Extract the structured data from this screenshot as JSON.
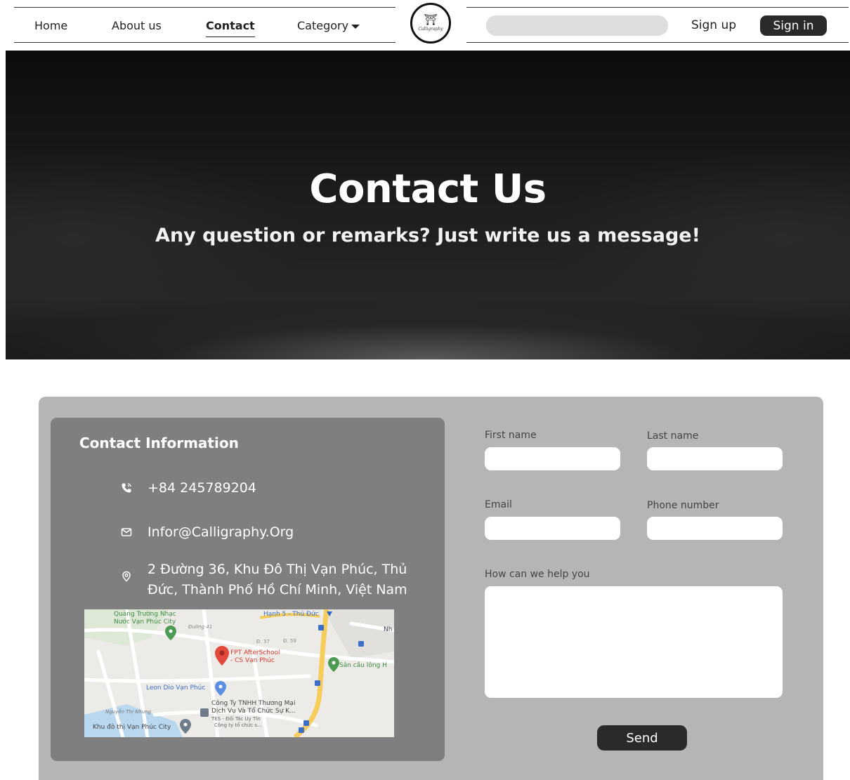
{
  "nav": {
    "links": [
      {
        "label": "Home"
      },
      {
        "label": "About us"
      },
      {
        "label": "Contact"
      },
      {
        "label": "Category"
      }
    ],
    "logo_text": "Calligraphy",
    "logo_glyph": "⛩",
    "search_placeholder": "",
    "signup_label": "Sign up",
    "signin_label": "Sign in"
  },
  "hero": {
    "title": "Contact Us",
    "subtitle": "Any question or remarks? Just write us a message!"
  },
  "contact_info": {
    "title": "Contact Information",
    "phone": "+84 245789204",
    "email": "Infor@Calligraphy.Org",
    "address_line1": "2 Đường 36, Khu Đô Thị Vạn Phúc, Thủ",
    "address_line2": "Đức, Thành Phố Hồ Chí Minh, Việt Nam",
    "icons": [
      "phone-icon",
      "mail-icon",
      "location-pin-icon"
    ]
  },
  "map": {
    "labels": {
      "plaza": "Quảng Trường Nhạc",
      "plaza2": "Nước Vạn Phúc City",
      "station": "Hạnh 5 - Thủ Đức",
      "fpt": "FPT AfterSchool",
      "fpt2": "- CS Vạn Phúc",
      "court": "Sân cầu lông H",
      "leon": "Leon Dio Vạn Phúc",
      "company": "Công Ty TNHH Thương Mại",
      "company2": "Dịch Vụ Và Tổ Chức Sự K...",
      "tes": "TES - Đối Tác Uy Tín",
      "tes2": "Công ty tổ chức s...",
      "khu": "Khu đô thị Vạn Phúc City",
      "duong41": "Đường 41",
      "d59": "Đ. 59",
      "d37": "Đ. 37",
      "nguyen": "Nguyễn Thị Nhung",
      "nh": "Nh"
    }
  },
  "form": {
    "first_name_label": "First name",
    "last_name_label": "Last name",
    "email_label": "Email",
    "phone_label": "Phone number",
    "message_label": "How can we help you",
    "send_label": "Send"
  },
  "colors": {
    "panel": "#b5b5b5",
    "card": "#7f7f7f",
    "button": "#2a2a2a"
  }
}
